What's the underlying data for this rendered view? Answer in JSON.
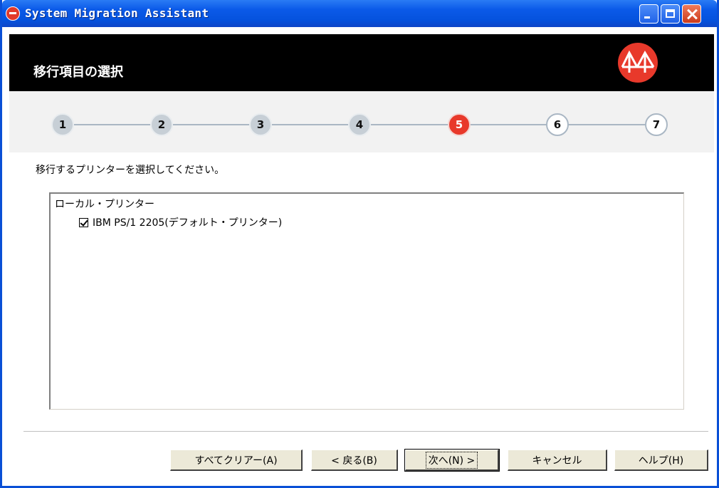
{
  "window": {
    "title": "System Migration Assistant",
    "controls": [
      "minimize",
      "maximize",
      "close"
    ]
  },
  "header": {
    "title": "移行項目の選択",
    "logo_icon": "migration-bridge-logo"
  },
  "steps": [
    {
      "label": "1",
      "state": "done"
    },
    {
      "label": "2",
      "state": "done"
    },
    {
      "label": "3",
      "state": "done"
    },
    {
      "label": "4",
      "state": "done"
    },
    {
      "label": "5",
      "state": "active"
    },
    {
      "label": "6",
      "state": "future"
    },
    {
      "label": "7",
      "state": "future"
    }
  ],
  "instruction": "移行するプリンターを選択してください。",
  "tree": {
    "group_label": "ローカル・プリンター",
    "items": [
      {
        "label": "IBM PS/1 2205(デフォルト・プリンター)",
        "checked": true
      }
    ]
  },
  "buttons": {
    "clear_all": "すべてクリアー(A)",
    "back": "< 戻る(B)",
    "next": "次へ(N) >",
    "cancel": "キャンセル",
    "help": "ヘルプ(H)"
  },
  "colors": {
    "titlebar": "#0552dd",
    "accent_red": "#e8392b",
    "header_bg": "#000000"
  }
}
